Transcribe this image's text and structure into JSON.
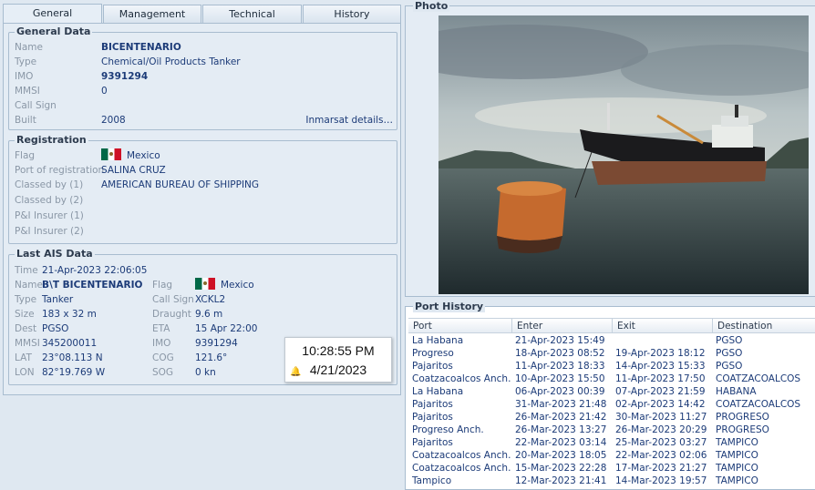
{
  "tabs": [
    "General",
    "Management",
    "Technical",
    "History"
  ],
  "general_data": {
    "title": "General Data",
    "fields": [
      {
        "label": "Name",
        "value": "BICENTENARIO",
        "bold": true
      },
      {
        "label": "Type",
        "value": "Chemical/Oil Products Tanker"
      },
      {
        "label": "IMO",
        "value": "9391294",
        "bold": true
      },
      {
        "label": "MMSI",
        "value": "0"
      },
      {
        "label": "Call Sign",
        "value": ""
      },
      {
        "label": "Built",
        "value": "2008"
      }
    ],
    "inmarsat_link": "Inmarsat details…"
  },
  "registration": {
    "title": "Registration",
    "flag_label": "Flag",
    "flag_country": "Mexico",
    "fields": [
      {
        "label": "Port of registration",
        "value": "SALINA CRUZ"
      },
      {
        "label": "Classed by (1)",
        "value": "AMERICAN BUREAU OF SHIPPING"
      },
      {
        "label": "Classed by (2)",
        "value": ""
      },
      {
        "label": "P&I Insurer (1)",
        "value": ""
      },
      {
        "label": "P&I Insurer (2)",
        "value": ""
      }
    ]
  },
  "ais": {
    "title": "Last AIS Data",
    "time_label": "Time",
    "time": "21-Apr-2023 22:06:05",
    "left": [
      {
        "label": "Name",
        "value": "B\\T BICENTENARIO",
        "bold": true
      },
      {
        "label": "Type",
        "value": "Tanker"
      },
      {
        "label": "Size",
        "value": "183 x 32 m"
      },
      {
        "label": "Dest",
        "value": "PGSO"
      },
      {
        "label": "MMSI",
        "value": "345200011"
      },
      {
        "label": "LAT",
        "value": "23°08.113 N"
      },
      {
        "label": "LON",
        "value": "82°19.769 W"
      }
    ],
    "right": [
      {
        "label": "Flag",
        "value": "Mexico"
      },
      {
        "label": "Call Sign",
        "value": "XCKL2"
      },
      {
        "label": "Draught",
        "value": "9.6 m"
      },
      {
        "label": "ETA",
        "value": "15 Apr 22:00"
      },
      {
        "label": "IMO",
        "value": "9391294"
      },
      {
        "label": "COG",
        "value": "121.6°"
      },
      {
        "label": "SOG",
        "value": "0 kn"
      }
    ]
  },
  "clock": {
    "time": "10:28:55 PM",
    "date": "4/21/2023"
  },
  "photo": {
    "title": "Photo"
  },
  "port_history": {
    "title": "Port History",
    "columns": [
      "Port",
      "Enter",
      "Exit",
      "Destination"
    ],
    "rows": [
      [
        "La Habana",
        "21-Apr-2023 15:49",
        "",
        "PGSO"
      ],
      [
        "Progreso",
        "18-Apr-2023 08:52",
        "19-Apr-2023 18:12",
        "PGSO"
      ],
      [
        "Pajaritos",
        "11-Apr-2023 18:33",
        "14-Apr-2023 15:33",
        "PGSO"
      ],
      [
        "Coatzacoalcos Anch.",
        "10-Apr-2023 15:50",
        "11-Apr-2023 17:50",
        "COATZACOALCOS"
      ],
      [
        "La Habana",
        "06-Apr-2023 00:39",
        "07-Apr-2023 21:59",
        "HABANA"
      ],
      [
        "Pajaritos",
        "31-Mar-2023 21:48",
        "02-Apr-2023 14:42",
        "COATZACOALCOS"
      ],
      [
        "Pajaritos",
        "26-Mar-2023 21:42",
        "30-Mar-2023 11:27",
        "PROGRESO"
      ],
      [
        "Progreso Anch.",
        "26-Mar-2023 13:27",
        "26-Mar-2023 20:29",
        "PROGRESO"
      ],
      [
        "Pajaritos",
        "22-Mar-2023 03:14",
        "25-Mar-2023 03:27",
        "TAMPICO"
      ],
      [
        "Coatzacoalcos Anch.",
        "20-Mar-2023 18:05",
        "22-Mar-2023 02:06",
        "TAMPICO"
      ],
      [
        "Coatzacoalcos Anch.",
        "15-Mar-2023 22:28",
        "17-Mar-2023 21:27",
        "TAMPICO"
      ],
      [
        "Tampico",
        "12-Mar-2023 21:41",
        "14-Mar-2023 19:57",
        "TAMPICO"
      ]
    ]
  }
}
